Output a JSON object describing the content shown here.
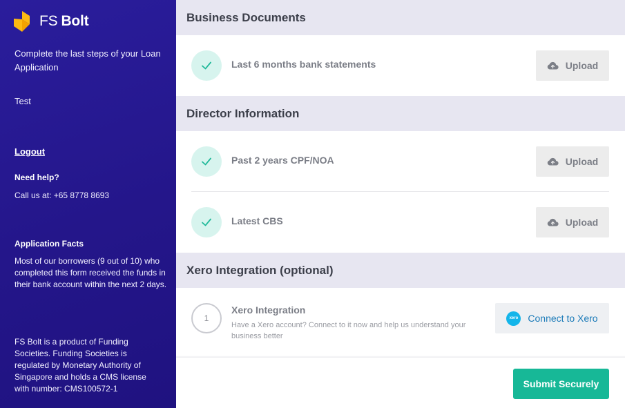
{
  "sidebar": {
    "brand_prefix": "FS",
    "brand_name": "Bolt",
    "intro": "Complete the last steps of your Loan Application",
    "applicant": "Test",
    "logout": "Logout",
    "help_title": "Need help?",
    "help_text": "Call us at: +65 8778 8693",
    "facts_title": "Application Facts",
    "facts_text": "Most of our borrowers (9 out of 10) who completed this form received the funds in their bank account within the next 2 days.",
    "footer": "FS Bolt is a product of Funding Societies. Funding Societies is regulated by Monetary Authority of Singapore and holds a CMS license with number: CMS100572-1"
  },
  "sections": {
    "business": {
      "title": "Business Documents",
      "items": [
        {
          "label": "Last 6 months bank statements",
          "status": "completed",
          "button": "Upload"
        }
      ]
    },
    "director": {
      "title": "Director Information",
      "items": [
        {
          "label": "Past 2 years CPF/NOA",
          "status": "completed",
          "button": "Upload"
        },
        {
          "label": "Latest CBS",
          "status": "completed",
          "button": "Upload"
        }
      ]
    },
    "xero": {
      "title": "Xero Integration (optional)",
      "step_number": "1",
      "item_title": "Xero Integration",
      "item_desc": "Have a Xero account? Connect to it now and help us understand your business better",
      "logo_text": "xero",
      "button": "Connect to Xero"
    }
  },
  "footer": {
    "submit": "Submit Securely"
  },
  "colors": {
    "sidebar_bg": "#24168a",
    "accent_green": "#17b897",
    "check_bg": "#d7f4ee",
    "section_header_bg": "#e7e6f1",
    "logo_yellow": "#fdb913",
    "xero_blue": "#13b5ea"
  },
  "icons": {
    "logo": "fs-bolt-logo-icon",
    "check": "check-icon",
    "upload": "cloud-upload-icon",
    "xero": "xero-logo-icon"
  }
}
